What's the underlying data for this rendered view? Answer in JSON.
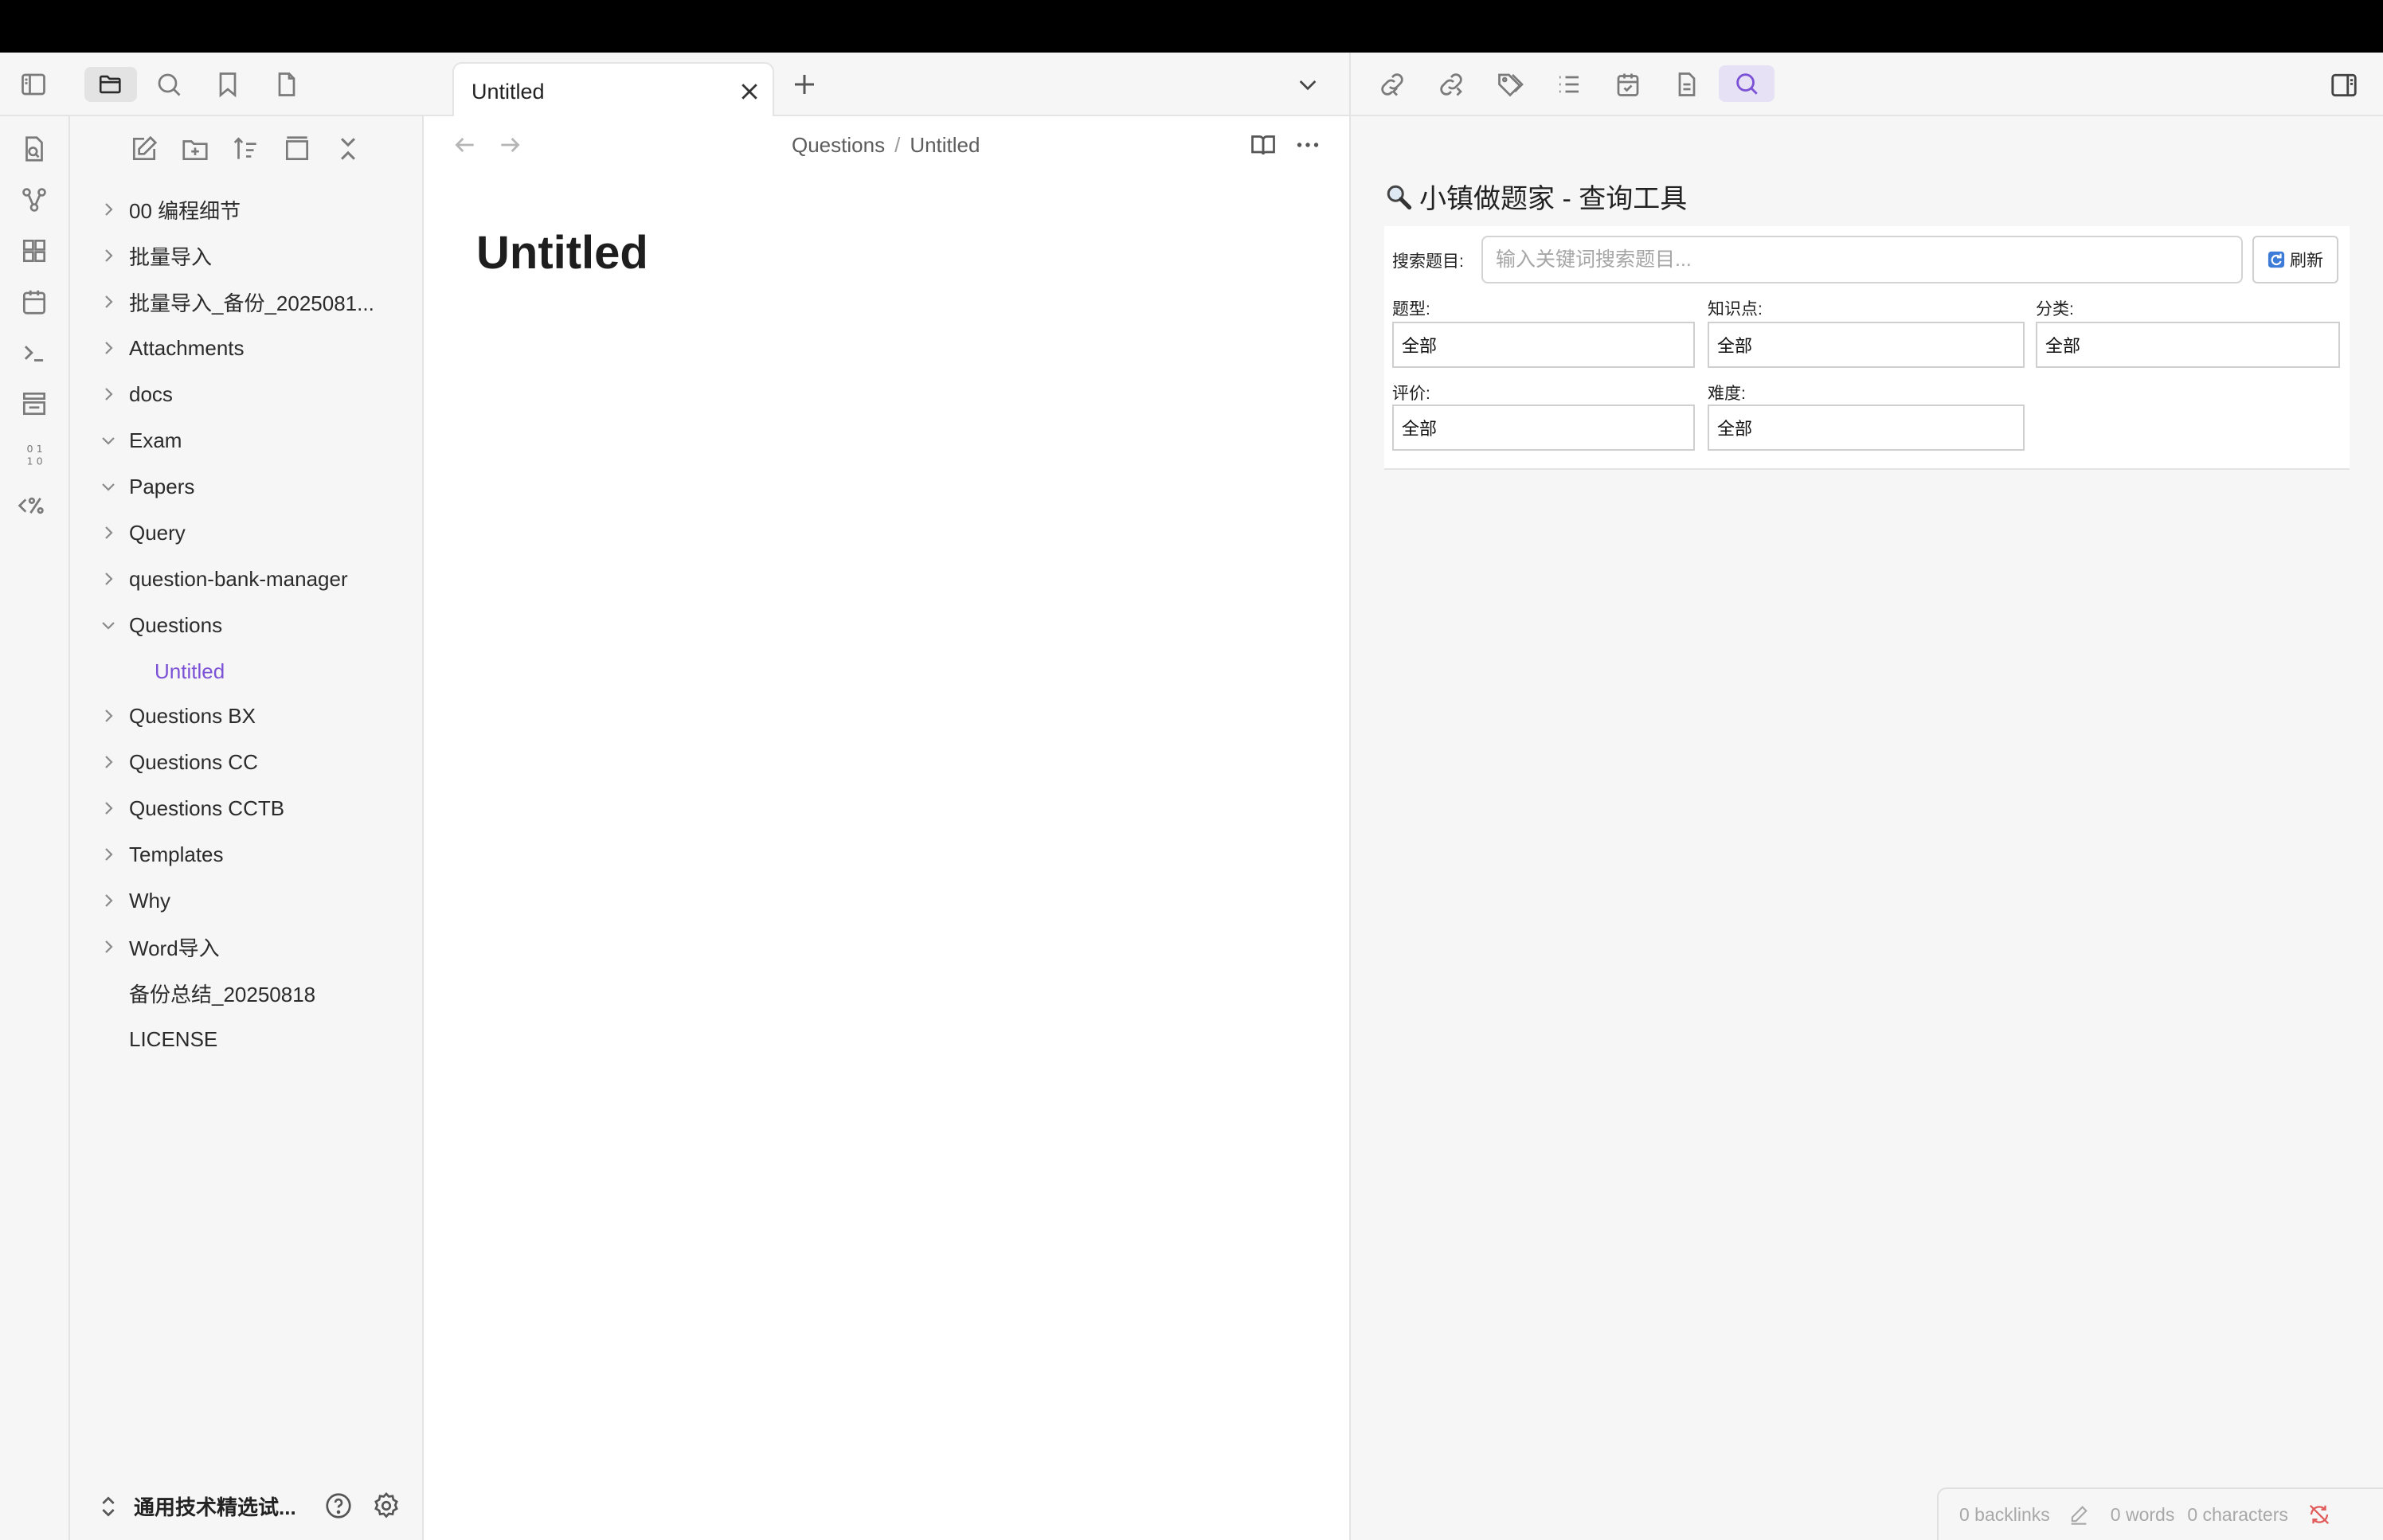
{
  "tab": {
    "title": "Untitled"
  },
  "breadcrumb": {
    "parent": "Questions",
    "separator": "/",
    "current": "Untitled"
  },
  "note": {
    "title": "Untitled"
  },
  "file_tree": [
    {
      "label": "00 编程细节",
      "expanded": false,
      "depth": 0,
      "folder": true
    },
    {
      "label": "批量导入",
      "expanded": false,
      "depth": 0,
      "folder": true
    },
    {
      "label": "批量导入_备份_2025081...",
      "expanded": false,
      "depth": 0,
      "folder": true
    },
    {
      "label": "Attachments",
      "expanded": false,
      "depth": 0,
      "folder": true
    },
    {
      "label": "docs",
      "expanded": false,
      "depth": 0,
      "folder": true
    },
    {
      "label": "Exam",
      "expanded": true,
      "depth": 0,
      "folder": true
    },
    {
      "label": "Papers",
      "expanded": true,
      "depth": 0,
      "folder": true
    },
    {
      "label": "Query",
      "expanded": false,
      "depth": 0,
      "folder": true
    },
    {
      "label": "question-bank-manager",
      "expanded": false,
      "depth": 0,
      "folder": true
    },
    {
      "label": "Questions",
      "expanded": true,
      "depth": 0,
      "folder": true
    },
    {
      "label": "Untitled",
      "expanded": false,
      "depth": 1,
      "folder": false,
      "active": true
    },
    {
      "label": "Questions BX",
      "expanded": false,
      "depth": 0,
      "folder": true
    },
    {
      "label": "Questions CC",
      "expanded": false,
      "depth": 0,
      "folder": true
    },
    {
      "label": "Questions CCTB",
      "expanded": false,
      "depth": 0,
      "folder": true
    },
    {
      "label": "Templates",
      "expanded": false,
      "depth": 0,
      "folder": true
    },
    {
      "label": "Why",
      "expanded": false,
      "depth": 0,
      "folder": true
    },
    {
      "label": "Word导入",
      "expanded": false,
      "depth": 0,
      "folder": true
    },
    {
      "label": "备份总结_20250818",
      "expanded": false,
      "depth": 0,
      "folder": false
    },
    {
      "label": "LICENSE",
      "expanded": false,
      "depth": 0,
      "folder": false
    }
  ],
  "vault": {
    "name": "通用技术精选试..."
  },
  "query_tool": {
    "title_icon": "magnifier-emoji-icon",
    "title": "小镇做题家 - 查询工具",
    "search_label": "搜索题目:",
    "search_placeholder": "输入关键词搜索题目...",
    "refresh_label": "刷新",
    "filters": [
      {
        "label": "题型:",
        "value": "全部"
      },
      {
        "label": "知识点:",
        "value": "全部"
      },
      {
        "label": "分类:",
        "value": "全部"
      },
      {
        "label": "评价:",
        "value": "全部"
      },
      {
        "label": "难度:",
        "value": "全部"
      }
    ]
  },
  "status": {
    "backlinks": "0 backlinks",
    "words": "0 words",
    "characters": "0 characters"
  },
  "colors": {
    "accent": "#7b52d6",
    "active_tab_bg": "#e6e1f5",
    "panel_bg": "#f6f6f6"
  }
}
